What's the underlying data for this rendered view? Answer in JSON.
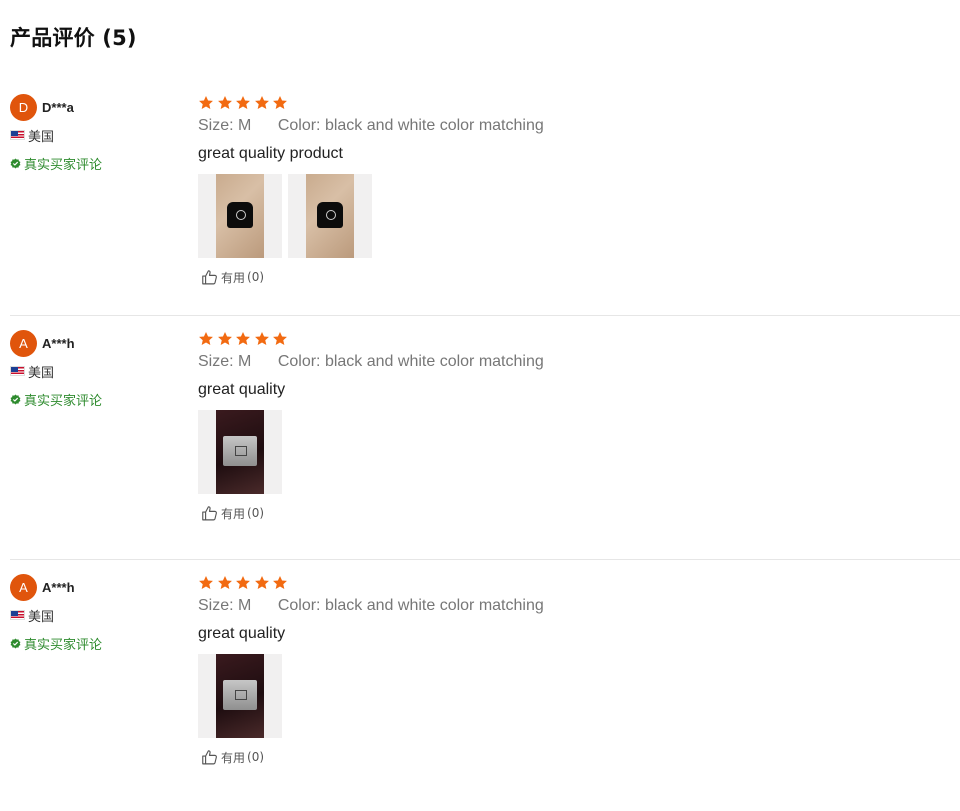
{
  "page": {
    "title": "产品评价 (5)"
  },
  "colors": {
    "accent_orange": "#e0550c",
    "star_orange": "#f26a11",
    "verified_green": "#2e8b2e"
  },
  "reviews": [
    {
      "avatar_letter": "D",
      "username": "D***a",
      "country_flag_icon": "us-flag-icon",
      "country": "美国",
      "verified_label": "真实买家评论",
      "rating": 5,
      "size_label": "Size:",
      "size_value": "M",
      "color_label": "Color:",
      "color_value": "black and white color matching",
      "text": "great quality product",
      "photos": [
        "review-photo-hoodie-1",
        "review-photo-hoodie-2"
      ],
      "helpful_label": "有用",
      "helpful_count": "(0)"
    },
    {
      "avatar_letter": "A",
      "username": "A***h",
      "country_flag_icon": "us-flag-icon",
      "country": "美国",
      "verified_label": "真实买家评论",
      "rating": 5,
      "size_label": "Size:",
      "size_value": "M",
      "color_label": "Color:",
      "color_value": "black and white color matching",
      "text": "great quality",
      "photos": [
        "review-photo-package"
      ],
      "helpful_label": "有用",
      "helpful_count": "(0)"
    },
    {
      "avatar_letter": "A",
      "username": "A***h",
      "country_flag_icon": "us-flag-icon",
      "country": "美国",
      "verified_label": "真实买家评论",
      "rating": 5,
      "size_label": "Size:",
      "size_value": "M",
      "color_label": "Color:",
      "color_value": "black and white color matching",
      "text": "great quality",
      "photos": [
        "review-photo-package"
      ],
      "helpful_label": "有用",
      "helpful_count": "(0)"
    }
  ]
}
